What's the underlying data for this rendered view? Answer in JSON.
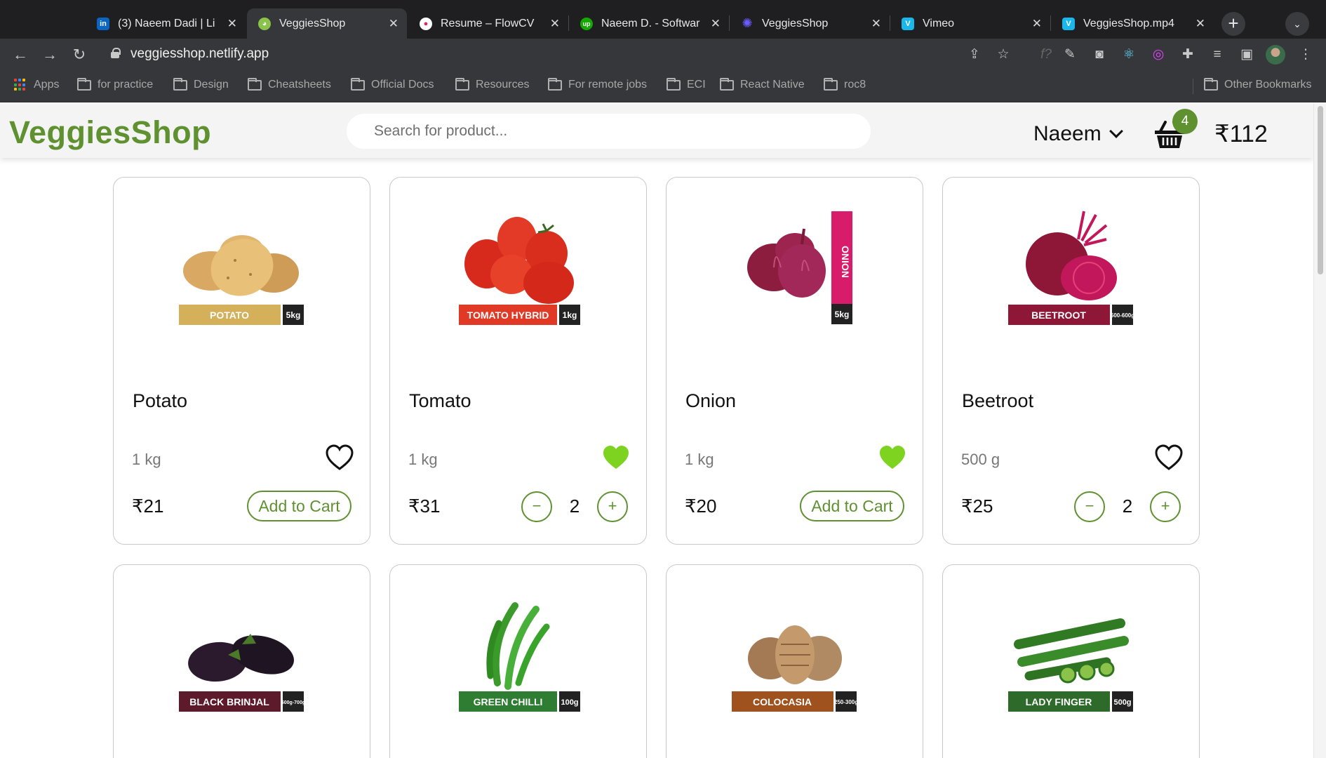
{
  "browser": {
    "tabs": [
      {
        "title": "(3) Naeem Dadi | Li",
        "favicon": "linkedin-icon"
      },
      {
        "title": "VeggiesShop",
        "favicon": "veggies-icon"
      },
      {
        "title": "Resume – FlowCV",
        "favicon": "flowcv-icon"
      },
      {
        "title": "Naeem D. - Softwar",
        "favicon": "upwork-icon"
      },
      {
        "title": "VeggiesShop",
        "favicon": "gear-flower-icon"
      },
      {
        "title": "Vimeo",
        "favicon": "vimeo-icon"
      },
      {
        "title": "VeggiesShop.mp4",
        "favicon": "vimeo-icon"
      }
    ],
    "url": "veggiesshop.netlify.app",
    "bookmarks": [
      "Apps",
      "for practice",
      "Design",
      "Cheatsheets",
      "Official Docs",
      "Resources",
      "For remote jobs",
      "ECI",
      "React Native",
      "roc8"
    ],
    "other_bookmarks": "Other Bookmarks"
  },
  "app": {
    "logo": "VeggiesShop",
    "search_placeholder": "Search for product...",
    "user_name": "Naeem",
    "cart_count": "4",
    "cart_total": "₹112",
    "accent_color": "#5f9131",
    "heart_color": "#7ed321"
  },
  "products": [
    {
      "name": "Potato",
      "qty": "1 kg",
      "price": "₹21",
      "liked": false,
      "in_cart": 0,
      "pack_label": "POTATO",
      "pack_weight": "5kg",
      "add_label": "Add to Cart"
    },
    {
      "name": "Tomato",
      "qty": "1 kg",
      "price": "₹31",
      "liked": true,
      "in_cart": 2,
      "pack_label": "TOMATO HYBRID",
      "pack_weight": "1kg"
    },
    {
      "name": "Onion",
      "qty": "1 kg",
      "price": "₹20",
      "liked": true,
      "in_cart": 0,
      "pack_label": "ONION",
      "pack_weight": "5kg",
      "add_label": "Add to Cart"
    },
    {
      "name": "Beetroot",
      "qty": "500 g",
      "price": "₹25",
      "liked": false,
      "in_cart": 2,
      "pack_label": "BEETROOT",
      "pack_weight": "500-600g"
    },
    {
      "pack_label": "BLACK BRINJAL",
      "pack_weight": "500g-700g"
    },
    {
      "pack_label": "GREEN CHILLI",
      "pack_weight": "100g"
    },
    {
      "pack_label": "COLOCASIA",
      "pack_weight": "250-300g"
    },
    {
      "pack_label": "LADY FINGER",
      "pack_weight": "500g"
    }
  ],
  "stepper": {
    "minus": "−",
    "plus": "+"
  }
}
